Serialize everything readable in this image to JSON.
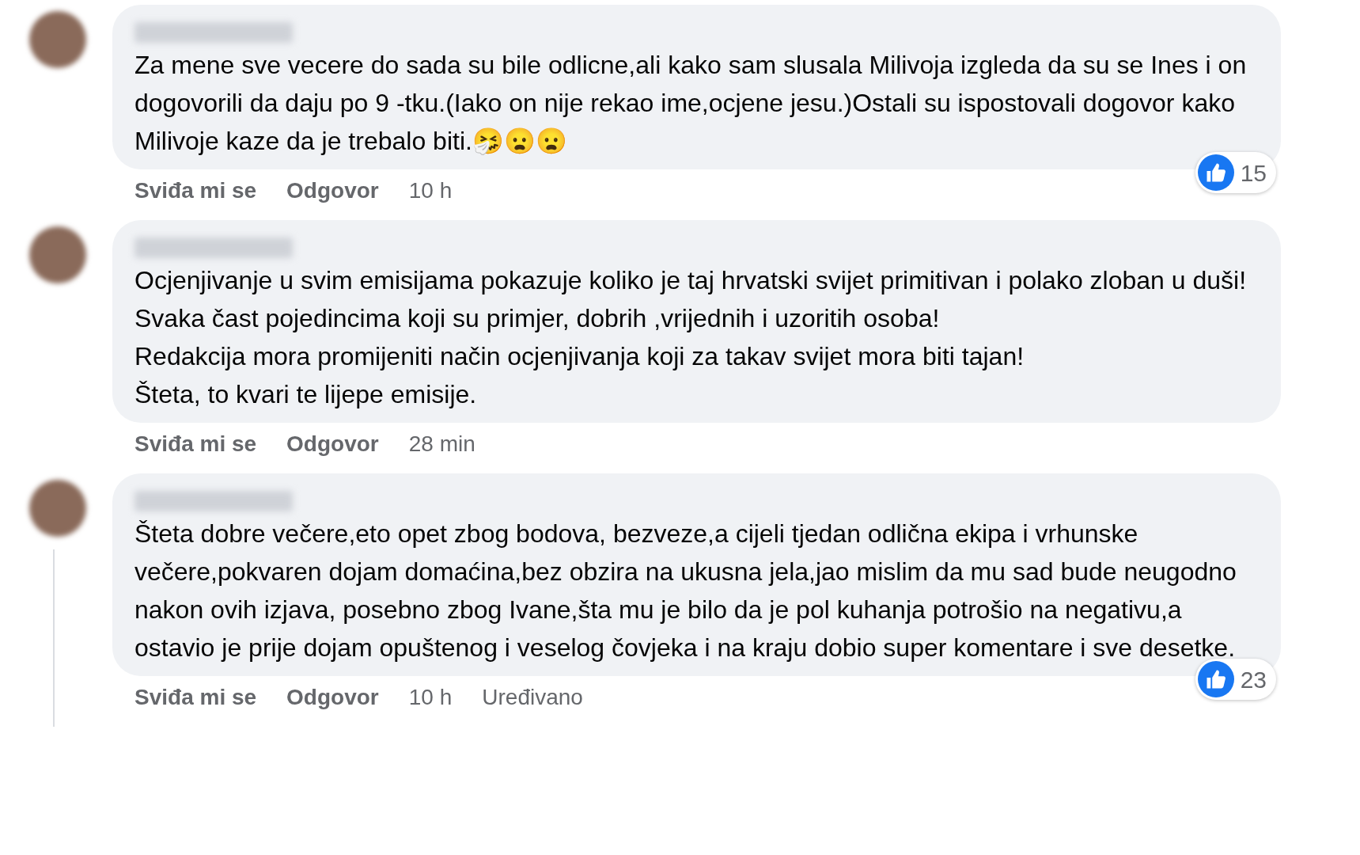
{
  "comments": [
    {
      "paragraphs": [
        "Za mene sve vecere do sada su bile odlicne,ali kako sam slusala Milivoja izgleda da su se Ines i on dogovorili da daju po 9 -tku.(Iako on nije rekao ime,ocjene jesu.)Ostali su ispostovali dogovor kako Milivoje kaze da je trebalo biti.🤧😦😦"
      ],
      "like": "Sviđa mi se",
      "reply": "Odgovor",
      "time": "10 h",
      "reactions": "15",
      "thread": false
    },
    {
      "paragraphs": [
        "Ocjenjivanje u svim emisijama pokazuje koliko je taj hrvatski svijet primitivan i polako zloban u duši!",
        "Svaka čast pojedincima koji su primjer, dobrih ,vrijednih i uzoritih osoba!",
        "Redakcija mora promijeniti način ocjenjivanja koji za takav svijet mora biti tajan!",
        "Šteta, to kvari te lijepe emisije."
      ],
      "like": "Sviđa mi se",
      "reply": "Odgovor",
      "time": "28 min",
      "thread": false
    },
    {
      "paragraphs": [
        "Šteta dobre večere,eto opet zbog bodova, bezveze,a cijeli tjedan odlična ekipa i vrhunske večere,pokvaren dojam domaćina,bez obzira na ukusna jela,jao mislim da mu sad bude neugodno nakon ovih izjava, posebno zbog Ivane,šta mu je bilo da je pol kuhanja potrošio na negativu,a ostavio je prije dojam opuštenog i veselog čovjeka i na kraju dobio super komentare i sve desetke."
      ],
      "like": "Sviđa mi se",
      "reply": "Odgovor",
      "time": "10 h",
      "edited": "Uređivano",
      "reactions": "23",
      "thread": true
    }
  ]
}
